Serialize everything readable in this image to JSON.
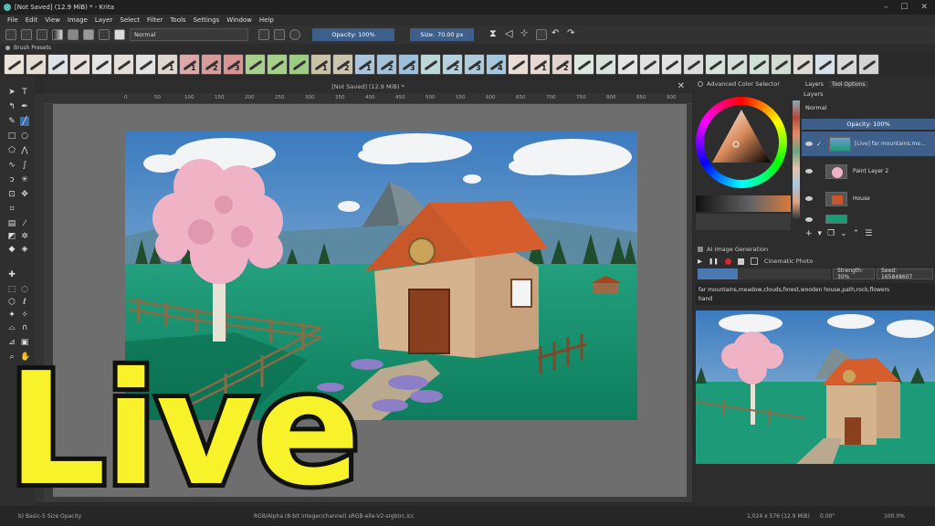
{
  "window": {
    "title": "[Not Saved]  (12.9 MiB) * - Krita",
    "controls": [
      "–",
      "☐",
      "✕"
    ]
  },
  "menu": [
    "File",
    "Edit",
    "View",
    "Image",
    "Layer",
    "Select",
    "Filter",
    "Tools",
    "Settings",
    "Window",
    "Help"
  ],
  "toolbar": {
    "blend_mode": "Normal",
    "opacity": "Opacity: 100%",
    "size_label": "Size:",
    "size_value": "70.00 px"
  },
  "brush_presets": {
    "label": "Brush Presets",
    "items": [
      {
        "color": "#e9e3da",
        "num": ""
      },
      {
        "color": "#e5ddd2",
        "num": ""
      },
      {
        "color": "#dfe3e7",
        "num": ""
      },
      {
        "color": "#e7e0dc",
        "num": ""
      },
      {
        "color": "#e4e4e4",
        "num": ""
      },
      {
        "color": "#e6dfd9",
        "num": ""
      },
      {
        "color": "#e2e2e2",
        "num": ""
      },
      {
        "color": "#ded6cf",
        "num": "1"
      },
      {
        "color": "#dca8a8",
        "num": "1"
      },
      {
        "color": "#d79c9c",
        "num": "2"
      },
      {
        "color": "#d89494",
        "num": "3"
      },
      {
        "color": "#a8cf8d",
        "num": ""
      },
      {
        "color": "#a6d08a",
        "num": ""
      },
      {
        "color": "#9fcc84",
        "num": ""
      },
      {
        "color": "#c9c2a6",
        "num": "1"
      },
      {
        "color": "#c9c4ad",
        "num": "2"
      },
      {
        "color": "#a9c6dc",
        "num": "1"
      },
      {
        "color": "#a4c1da",
        "num": "2"
      },
      {
        "color": "#9ec0db",
        "num": "3"
      },
      {
        "color": "#bcd7d8",
        "num": ""
      },
      {
        "color": "#b5d1dd",
        "num": "2"
      },
      {
        "color": "#aecbdc",
        "num": "3"
      },
      {
        "color": "#a4c7de",
        "num": "4"
      },
      {
        "color": "#e9ddd6",
        "num": ""
      },
      {
        "color": "#e7d9d2",
        "num": "1"
      },
      {
        "color": "#e3d3cd",
        "num": "2"
      },
      {
        "color": "#dce7dd",
        "num": ""
      },
      {
        "color": "#d9e2da",
        "num": ""
      },
      {
        "color": "#e4e4e4",
        "num": ""
      },
      {
        "color": "#e0e0e0",
        "num": ""
      },
      {
        "color": "#e2e2e2",
        "num": ""
      },
      {
        "color": "#dcdcdc",
        "num": ""
      },
      {
        "color": "#d7e2dd",
        "num": ""
      },
      {
        "color": "#d2ded8",
        "num": ""
      },
      {
        "color": "#cfe0d6",
        "num": ""
      },
      {
        "color": "#d1dcd1",
        "num": ""
      },
      {
        "color": "#e0dcd5",
        "num": ""
      },
      {
        "color": "#d6e1e9",
        "num": ""
      },
      {
        "color": "#d9d9d9",
        "num": ""
      },
      {
        "color": "#d3d3d3",
        "num": ""
      }
    ]
  },
  "document": {
    "tab_title": "[Not Saved]  (12.9 MiB) *",
    "ruler_ticks": [
      "0",
      "50",
      "100",
      "150",
      "200",
      "250",
      "300",
      "350",
      "400",
      "450",
      "500",
      "550",
      "600",
      "650",
      "700",
      "750",
      "800",
      "850",
      "900",
      "950",
      "1000",
      "1050"
    ]
  },
  "color_selector": {
    "title": "Advanced Color Selector"
  },
  "layers_panel": {
    "tabs": [
      "Layers",
      "Tool Options"
    ],
    "title": "Layers",
    "blend_mode": "Normal",
    "opacity": "Opacity:  100%",
    "layers": [
      {
        "name": "[Live] far mountains,me..."
      },
      {
        "name": "Paint Layer 2"
      },
      {
        "name": "House"
      },
      {
        "name": ""
      }
    ]
  },
  "ai_panel": {
    "title": "AI Image Generation",
    "style": "Cinematic Photo",
    "strength": "Strength: 30%",
    "seed": "Seed: 165848607",
    "prompt_line1": "far mountains,meadow,clouds,forest,wooden house,path,rock,flowers",
    "prompt_line2": "hand"
  },
  "status": {
    "brush": "b) Basic-5 Size Opacity",
    "color_space": "RGB/Alpha (8-bit integer/channel)  sRGB-elle-V2-srgbtrc.icc",
    "dimensions": "1,024 x 576 (12.9 MiB)",
    "rotation": "0.00°",
    "zoom": "100.0%"
  },
  "overlay": {
    "live_text": "Live",
    "fill": "#f7f22a",
    "stroke": "#111111"
  }
}
